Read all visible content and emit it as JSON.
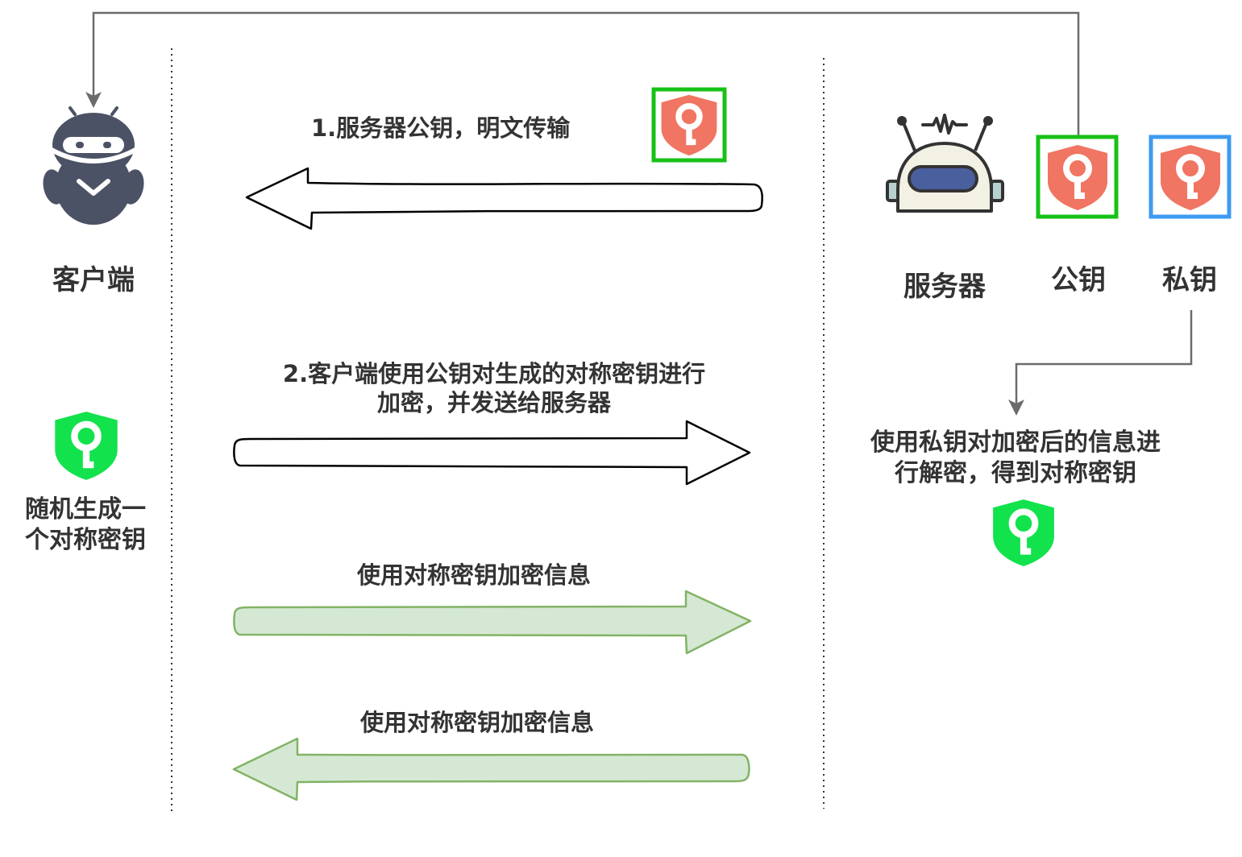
{
  "actors": {
    "client_label": "客户端",
    "server_label": "服务器",
    "public_key_label": "公钥",
    "private_key_label": "私钥"
  },
  "steps": {
    "step1": "1.服务器公钥，明文传输",
    "step2_line1": "2.客户端使用公钥对生成的对称密钥进行",
    "step2_line2": "加密，并发送给服务器",
    "step3": "使用对称密钥加密信息",
    "step4": "使用对称密钥加密信息"
  },
  "client_note": {
    "line1": "随机生成一",
    "line2": "个对称密钥"
  },
  "server_note": {
    "line1": "使用私钥对加密后的信息进",
    "line2": "行解密，得到对称密钥"
  },
  "colors": {
    "public_key_shield": "#f07562",
    "symmetric_key_shield": "#12e24c",
    "public_key_frame": "#17c117",
    "private_key_frame": "#3d9bf2",
    "encrypted_arrow_fill": "#d5e8d4",
    "encrypted_arrow_stroke": "#82b366",
    "connector": "#6b6b6b",
    "client_robot": "#4c5265",
    "server_visor": "#4a5f9e"
  },
  "icons": [
    "client-robot-icon",
    "server-robot-icon",
    "public-key-shield-icon",
    "private-key-shield-icon",
    "symmetric-key-shield-icon"
  ]
}
